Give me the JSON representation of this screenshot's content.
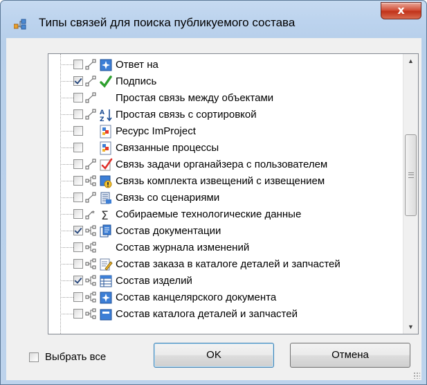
{
  "window": {
    "title": "Типы связей для поиска публикуемого состава",
    "close_label": "x"
  },
  "tree": {
    "items": [
      {
        "label": "Ответ на",
        "checked": false,
        "link_icon": "link-icon",
        "type_icon": "star-doc-icon"
      },
      {
        "label": "Подпись",
        "checked": true,
        "link_icon": "link-icon",
        "type_icon": "green-check-icon"
      },
      {
        "label": "Простая связь между объектами",
        "checked": false,
        "link_icon": "link-icon",
        "type_icon": ""
      },
      {
        "label": "Простая связь с сортировкой",
        "checked": false,
        "link_icon": "link-icon",
        "type_icon": "sort-az-icon"
      },
      {
        "label": "Ресурс ImProject",
        "checked": false,
        "link_icon": "",
        "type_icon": "resource-icon"
      },
      {
        "label": "Связанные процессы",
        "checked": false,
        "link_icon": "",
        "type_icon": "process-icon"
      },
      {
        "label": "Связь задачи органайзера с пользователем",
        "checked": false,
        "link_icon": "link-icon",
        "type_icon": "task-check-icon"
      },
      {
        "label": "Связь комплекта извещений с извещением",
        "checked": false,
        "link_icon": "hierarchy-link-icon",
        "type_icon": "notice-set-icon"
      },
      {
        "label": "Связь со сценариями",
        "checked": false,
        "link_icon": "link-icon",
        "type_icon": "script-icon"
      },
      {
        "label": "Собираемые технологические данные",
        "checked": false,
        "link_icon": "asterisk-link-icon",
        "type_icon": "sigma-icon"
      },
      {
        "label": "Состав документации",
        "checked": true,
        "link_icon": "hierarchy-link-icon",
        "type_icon": "documents-icon"
      },
      {
        "label": "Состав журнала изменений",
        "checked": false,
        "link_icon": "hierarchy-link-icon",
        "type_icon": ""
      },
      {
        "label": "Состав заказа в каталоге деталей и запчастей",
        "checked": false,
        "link_icon": "hierarchy-link-icon",
        "type_icon": "order-edit-icon"
      },
      {
        "label": "Состав изделий",
        "checked": true,
        "link_icon": "hierarchy-link-icon",
        "type_icon": "table-icon"
      },
      {
        "label": "Состав канцелярского документа",
        "checked": false,
        "link_icon": "hierarchy-link-icon",
        "type_icon": "star-doc-icon"
      },
      {
        "label": "Состав каталога деталей и запчастей",
        "checked": false,
        "link_icon": "hierarchy-link-icon",
        "type_icon": "catalog-icon"
      }
    ]
  },
  "footer": {
    "select_all_label": "Выбрать все",
    "select_all_checked": false,
    "ok_label": "OK",
    "cancel_label": "Отмена"
  },
  "colors": {
    "title_gradient": "#bcd3ee",
    "close_button": "#c1331a",
    "client_background": "#f0f0f0",
    "check_mark": "#2b4a7e"
  }
}
